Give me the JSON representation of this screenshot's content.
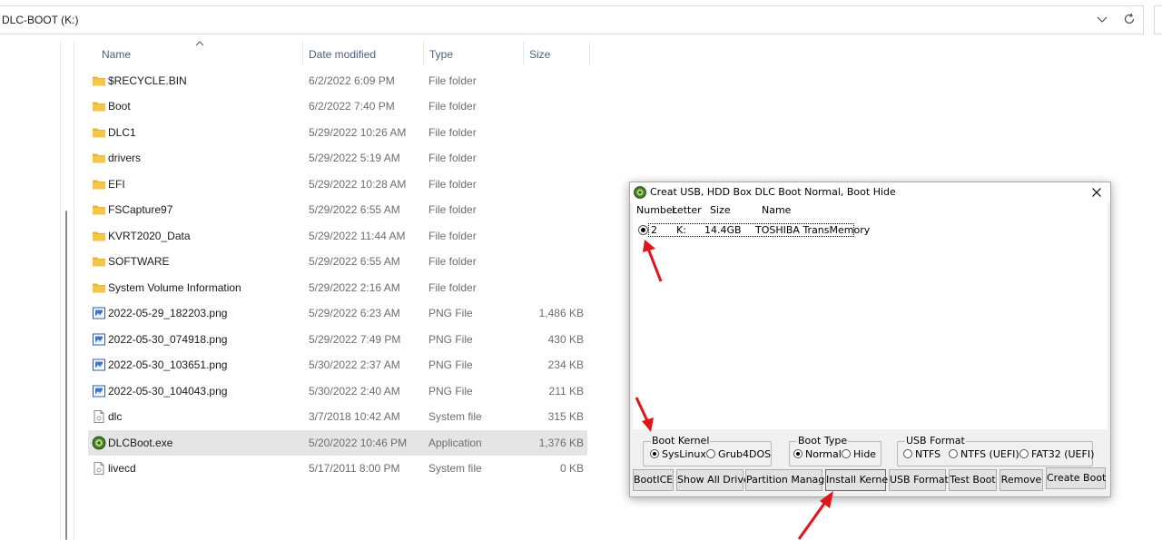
{
  "address_bar": {
    "path": "DLC-BOOT (K:)"
  },
  "columns": {
    "name": "Name",
    "date": "Date modified",
    "type": "Type",
    "size": "Size"
  },
  "files": [
    {
      "name": "$RECYCLE.BIN",
      "date": "6/2/2022 6:09 PM",
      "type": "File folder",
      "size": "",
      "icon": "folder-icon"
    },
    {
      "name": "Boot",
      "date": "6/2/2022 7:40 PM",
      "type": "File folder",
      "size": "",
      "icon": "folder-icon"
    },
    {
      "name": "DLC1",
      "date": "5/29/2022 10:26 AM",
      "type": "File folder",
      "size": "",
      "icon": "folder-icon"
    },
    {
      "name": "drivers",
      "date": "5/29/2022 5:19 AM",
      "type": "File folder",
      "size": "",
      "icon": "folder-icon"
    },
    {
      "name": "EFI",
      "date": "5/29/2022 10:28 AM",
      "type": "File folder",
      "size": "",
      "icon": "folder-icon"
    },
    {
      "name": "FSCapture97",
      "date": "5/29/2022 6:55 AM",
      "type": "File folder",
      "size": "",
      "icon": "folder-icon"
    },
    {
      "name": "KVRT2020_Data",
      "date": "5/29/2022 11:44 AM",
      "type": "File folder",
      "size": "",
      "icon": "folder-icon"
    },
    {
      "name": "SOFTWARE",
      "date": "5/29/2022 6:55 AM",
      "type": "File folder",
      "size": "",
      "icon": "folder-icon"
    },
    {
      "name": "System Volume Information",
      "date": "5/29/2022 2:16 AM",
      "type": "File folder",
      "size": "",
      "icon": "folder-icon"
    },
    {
      "name": "2022-05-29_182203.png",
      "date": "5/29/2022 6:23 AM",
      "type": "PNG File",
      "size": "1,486 KB",
      "icon": "image-file-icon"
    },
    {
      "name": "2022-05-30_074918.png",
      "date": "5/29/2022 7:49 PM",
      "type": "PNG File",
      "size": "430 KB",
      "icon": "image-file-icon"
    },
    {
      "name": "2022-05-30_103651.png",
      "date": "5/30/2022 2:37 AM",
      "type": "PNG File",
      "size": "234 KB",
      "icon": "image-file-icon"
    },
    {
      "name": "2022-05-30_104043.png",
      "date": "5/30/2022 2:40 AM",
      "type": "PNG File",
      "size": "211 KB",
      "icon": "image-file-icon"
    },
    {
      "name": "dlc",
      "date": "3/7/2018 10:42 AM",
      "type": "System file",
      "size": "315 KB",
      "icon": "system-file-icon"
    },
    {
      "name": "DLCBoot.exe",
      "date": "5/20/2022 10:46 PM",
      "type": "Application",
      "size": "1,376 KB",
      "icon": "app-icon",
      "selected": true
    },
    {
      "name": "livecd",
      "date": "5/17/2011 8:00 PM",
      "type": "System file",
      "size": "0 KB",
      "icon": "system-file-icon"
    }
  ],
  "dialog": {
    "title": "Creat USB, HDD Box DLC Boot Normal, Boot Hide",
    "headers": {
      "number": "Number",
      "letter": "Letter",
      "size": "Size",
      "name": "Name"
    },
    "drive": {
      "number": "2",
      "letter": "K:",
      "size": "14.4GB",
      "name": "TOSHIBA TransMemory"
    },
    "boot_kernel": {
      "label": "Boot Kernel",
      "options": [
        "SysLinux",
        "Grub4DOS"
      ],
      "selected": "SysLinux"
    },
    "boot_type": {
      "label": "Boot Type",
      "options": [
        "Normal",
        "Hide"
      ],
      "selected": "Normal"
    },
    "usb_format": {
      "label": "USB Format",
      "options": [
        "NTFS",
        "NTFS (UEFI)",
        "FAT32 (UEFI)"
      ]
    },
    "buttons": [
      "BootICE",
      "Show All Drive",
      "Partition Manager",
      "Install Kernel",
      "USB Format",
      "Test Boot",
      "Remove",
      "Create Boot"
    ]
  },
  "colors": {
    "annotation_arrow": "#e0151b",
    "folder": "#f6c64a",
    "selection": "#e5e5e5"
  }
}
